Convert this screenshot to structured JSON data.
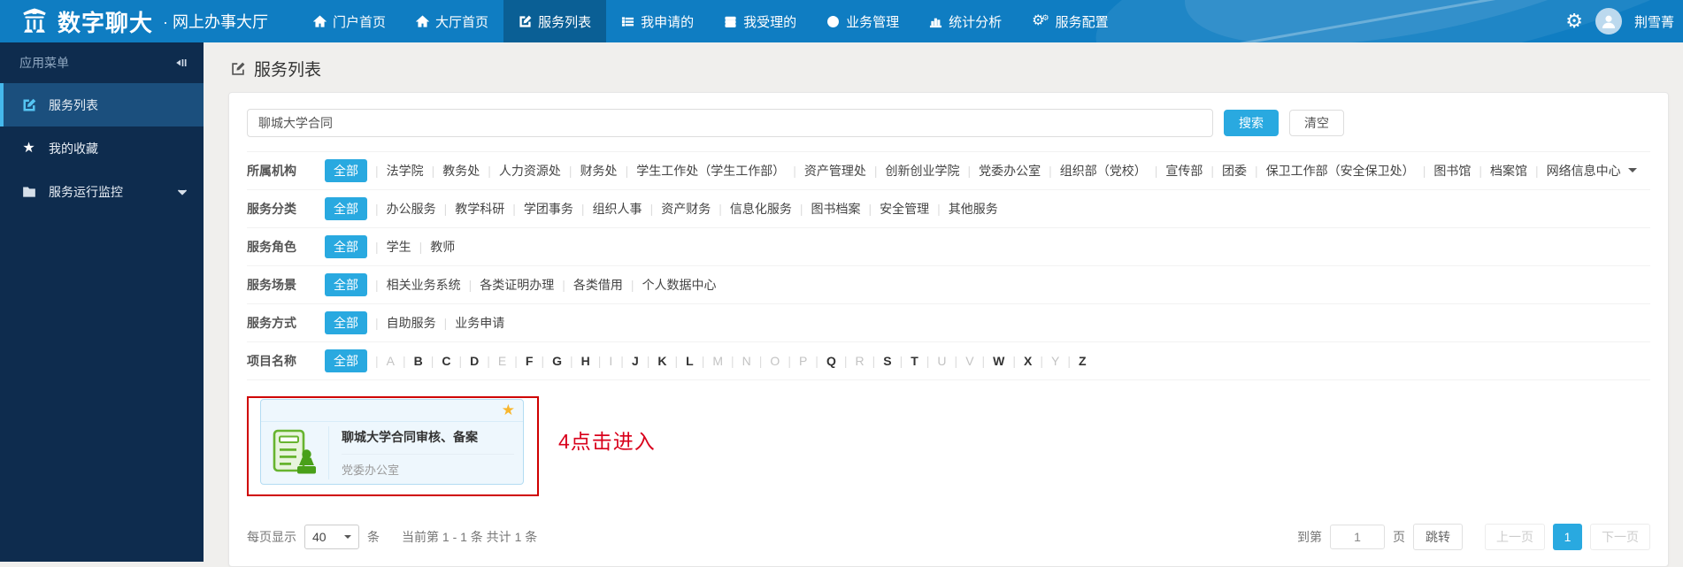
{
  "colors": {
    "navbar_blue": "#0f7dc2",
    "navbar_active": "#0a5f95",
    "sidebar_navy": "#0e2c4e",
    "sidebar_active": "#1b4f7d",
    "accent_blue": "#29a9e0",
    "annotation_red": "#d9001b",
    "star_gold": "#f8b62d",
    "icon_green": "#67b42f"
  },
  "navbar": {
    "logo_icon": "university-pavilion-icon",
    "logo_title": "数字聊大",
    "logo_separator": "·",
    "logo_subtitle": "网上办事大厅",
    "items": [
      {
        "id": "portal-home",
        "label": "门户首页",
        "icon": "home-icon"
      },
      {
        "id": "hall-home",
        "label": "大厅首页",
        "icon": "home-icon"
      },
      {
        "id": "service-list",
        "label": "服务列表",
        "icon": "edit-square-icon",
        "active": true
      },
      {
        "id": "my-applied",
        "label": "我申请的",
        "icon": "list-icon"
      },
      {
        "id": "my-accepted",
        "label": "我受理的",
        "icon": "server-icon"
      },
      {
        "id": "business-mgmt",
        "label": "业务管理",
        "icon": "globe-icon"
      },
      {
        "id": "stats",
        "label": "统计分析",
        "icon": "bar-chart-icon"
      },
      {
        "id": "service-config",
        "label": "服务配置",
        "icon": "gears-icon"
      }
    ],
    "settings_icon": "gear-icon",
    "avatar_icon": "user-avatar-icon",
    "username": "荆雪菁"
  },
  "sidebar": {
    "header": "应用菜单",
    "collapse_icon": "collapse-sidebar-icon",
    "items": [
      {
        "id": "service-list",
        "label": "服务列表",
        "icon": "edit-square-icon",
        "active": true
      },
      {
        "id": "favorites",
        "label": "我的收藏",
        "icon": "star-icon"
      },
      {
        "id": "monitor",
        "label": "服务运行监控",
        "icon": "folder-icon",
        "expandable": true
      }
    ]
  },
  "page": {
    "title": "服务列表",
    "title_icon": "edit-square-icon"
  },
  "search": {
    "value": "聊城大学合同",
    "search_label": "搜索",
    "clear_label": "清空"
  },
  "filter_section": {
    "all_label": "全部",
    "rows": [
      {
        "label": "所属机构",
        "options": [
          "法学院",
          "教务处",
          "人力资源处",
          "财务处",
          "学生工作处（学生工作部）",
          "资产管理处",
          "创新创业学院",
          "党委办公室",
          "组织部（党校）",
          "宣传部",
          "团委",
          "保卫工作部（安全保卫处）",
          "图书馆",
          "档案馆",
          "网络信息中心"
        ],
        "trailing_caret": true
      },
      {
        "label": "服务分类",
        "options": [
          "办公服务",
          "教学科研",
          "学团事务",
          "组织人事",
          "资产财务",
          "信息化服务",
          "图书档案",
          "安全管理",
          "其他服务"
        ]
      },
      {
        "label": "服务角色",
        "options": [
          "学生",
          "教师"
        ]
      },
      {
        "label": "服务场景",
        "options": [
          "相关业务系统",
          "各类证明办理",
          "各类借用",
          "个人数据中心"
        ]
      },
      {
        "label": "服务方式",
        "options": [
          "自助服务",
          "业务申请"
        ]
      },
      {
        "label": "项目名称",
        "letters": true,
        "options": [
          "A",
          "B",
          "C",
          "D",
          "E",
          "F",
          "G",
          "H",
          "I",
          "J",
          "K",
          "L",
          "M",
          "N",
          "O",
          "P",
          "Q",
          "R",
          "S",
          "T",
          "U",
          "V",
          "W",
          "X",
          "Y",
          "Z"
        ],
        "disabled_options": [
          "A",
          "E",
          "I",
          "M",
          "N",
          "O",
          "P",
          "R",
          "U",
          "V",
          "Y"
        ]
      }
    ]
  },
  "service_card": {
    "title": "聊城大学合同审核、备案",
    "dept": "党委办公室",
    "favorite_icon": "favorite-star-icon",
    "doc_icon": "document-stamp-icon",
    "favorite_glyph": "★"
  },
  "annotation": {
    "text": "4点击进入"
  },
  "pagination": {
    "per_page_label": "每页显示",
    "per_page_value": "40",
    "unit_label": "条",
    "summary": "当前第 1 - 1 条 共计 1 条",
    "goto_label": "到第",
    "goto_value": "1",
    "page_unit": "页",
    "jump_label": "跳转",
    "prev_label": "上一页",
    "current_page": "1",
    "next_label": "下一页"
  }
}
